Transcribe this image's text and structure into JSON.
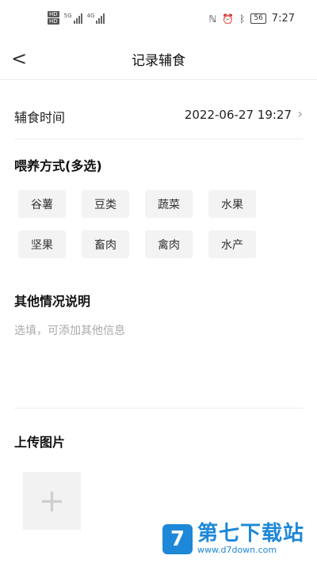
{
  "status_bar": {
    "hd1": "HD",
    "hd2": "HD",
    "net1": "5G",
    "net2": "4G",
    "battery": "56",
    "time": "7:27"
  },
  "nav": {
    "back": "<",
    "title": "记录辅食"
  },
  "feeding_time": {
    "label": "辅食时间",
    "value": "2022-06-27 19:27"
  },
  "feeding_method": {
    "label": "喂养方式(多选)",
    "options": [
      "谷薯",
      "豆类",
      "蔬菜",
      "水果",
      "坚果",
      "畜肉",
      "禽肉",
      "水产"
    ]
  },
  "other": {
    "label": "其他情况说明",
    "placeholder": "选填，可添加其他信息"
  },
  "upload": {
    "label": "上传图片",
    "plus": "+"
  },
  "watermark": {
    "logo": "7",
    "name": "第七下载站",
    "url": "www.d7down.com"
  }
}
